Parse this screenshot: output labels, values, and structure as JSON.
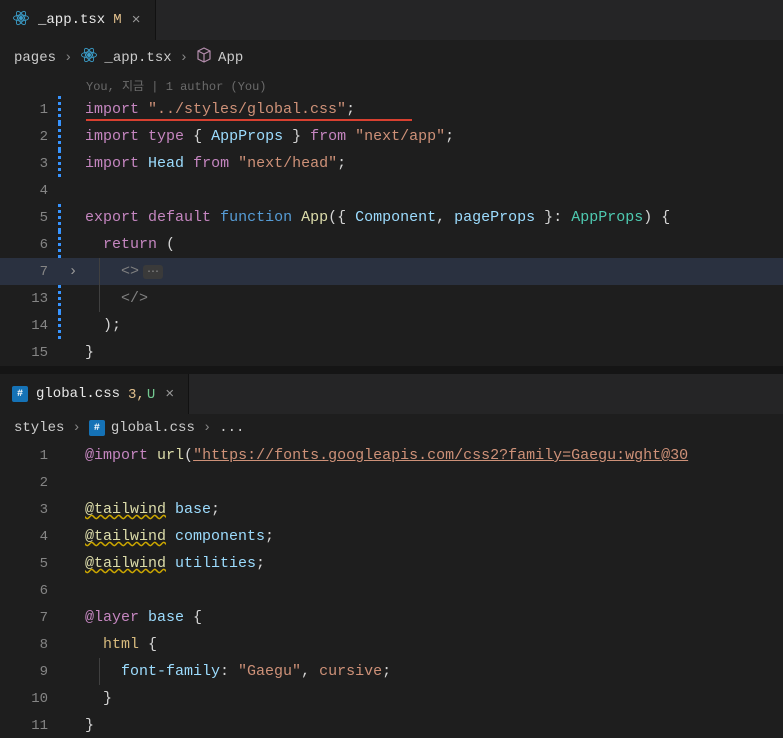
{
  "pane1": {
    "tab": {
      "filename": "_app.tsx",
      "status": "M"
    },
    "breadcrumb": {
      "seg1": "pages",
      "seg2": "_app.tsx",
      "seg3": "App"
    },
    "gitlens": "You, 지금 | 1 author (You)",
    "lines": {
      "l1_import": "import",
      "l1_str": "\"../styles/global.css\"",
      "l1_semi": ";",
      "l2": {
        "import": "import",
        "type": "type",
        "ob": "{ ",
        "name": "AppProps",
        "cb": " }",
        "from": "from",
        "str": "\"next/app\"",
        "semi": ";"
      },
      "l3": {
        "import": "import",
        "name": "Head",
        "from": "from",
        "str": "\"next/head\"",
        "semi": ";"
      },
      "l5": {
        "export": "export",
        "default": "default",
        "function": "function",
        "fn": "App",
        "op": "({ ",
        "p1": "Component",
        "c": ", ",
        "p2": "pageProps",
        "cp": " }",
        "colon": ": ",
        "type": "AppProps",
        "end": ") {"
      },
      "l6": {
        "return": "return",
        "paren": " ("
      },
      "l7": {
        "tag": "<>"
      },
      "l13": {
        "tag": "</>"
      },
      "l14": {
        "close": ");"
      },
      "l15": {
        "brace": "}"
      }
    },
    "gutters": {
      "n1": "1",
      "n2": "2",
      "n3": "3",
      "n4": "4",
      "n5": "5",
      "n6": "6",
      "n7": "7",
      "n13": "13",
      "n14": "14",
      "n15": "15"
    }
  },
  "pane2": {
    "tab": {
      "filename": "global.css",
      "count": "3,",
      "status": "U"
    },
    "breadcrumb": {
      "seg1": "styles",
      "seg2": "global.css",
      "seg3": "..."
    },
    "lines": {
      "l1": {
        "rule": "@import",
        "url_kw": "url",
        "op": "(",
        "url": "\"https://fonts.googleapis.com/css2?family=Gaegu:wght@30",
        "cp": ""
      },
      "l3": {
        "rule": "@tailwind",
        "val": "base",
        "semi": ";"
      },
      "l4": {
        "rule": "@tailwind",
        "val": "components",
        "semi": ";"
      },
      "l5": {
        "rule": "@tailwind",
        "val": "utilities",
        "semi": ";"
      },
      "l7": {
        "rule": "@layer",
        "val": "base",
        "brace": " {"
      },
      "l8": {
        "sel": "html",
        "brace": " {"
      },
      "l9": {
        "prop": "font-family",
        "colon": ": ",
        "v1": "\"Gaegu\"",
        "c": ", ",
        "v2": "cursive",
        "semi": ";"
      },
      "l10": {
        "brace": "}"
      },
      "l11": {
        "brace": "}"
      }
    },
    "gutters": {
      "n1": "1",
      "n2": "2",
      "n3": "3",
      "n4": "4",
      "n5": "5",
      "n6": "6",
      "n7": "7",
      "n8": "8",
      "n9": "9",
      "n10": "10",
      "n11": "11"
    }
  }
}
